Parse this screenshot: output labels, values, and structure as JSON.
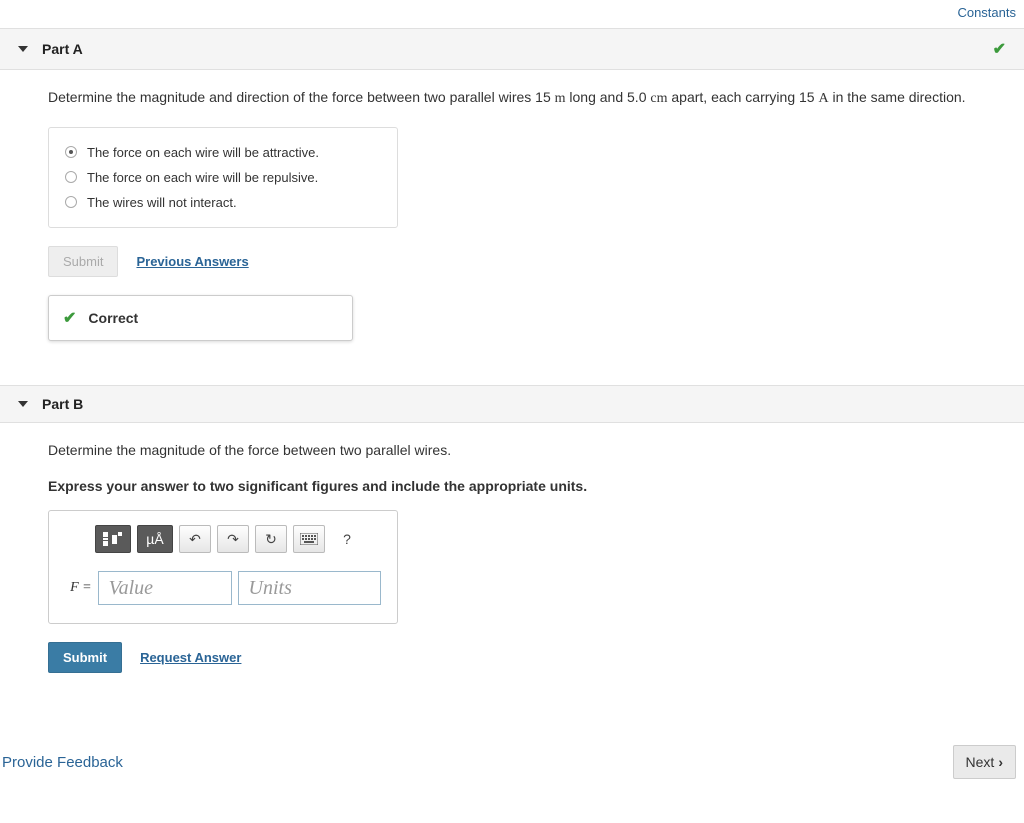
{
  "top": {
    "constants": "Constants"
  },
  "partA": {
    "title": "Part A",
    "prompt_pre": "Determine the magnitude and direction of the force between two parallel wires 15 ",
    "unit1": "m",
    "prompt_mid1": " long and 5.0 ",
    "unit2": "cm",
    "prompt_mid2": "   apart, each carrying 15 ",
    "unit3": "A",
    "prompt_post": " in the same direction.",
    "options": [
      "The force on each wire will be attractive.",
      "The force on each wire will be repulsive.",
      "The wires will not interact."
    ],
    "submit": "Submit",
    "prev": "Previous Answers",
    "feedback": "Correct"
  },
  "partB": {
    "title": "Part B",
    "prompt": "Determine the magnitude of the force between two parallel wires.",
    "instruct": "Express your answer to two significant figures and include the appropriate units.",
    "toolbar": {
      "units_symbol": "µÅ",
      "help": "?"
    },
    "eq_label": "F = ",
    "value_placeholder": "Value",
    "units_placeholder": "Units",
    "submit": "Submit",
    "request": "Request Answer"
  },
  "footer": {
    "feedback": "Provide Feedback",
    "next": "Next"
  }
}
